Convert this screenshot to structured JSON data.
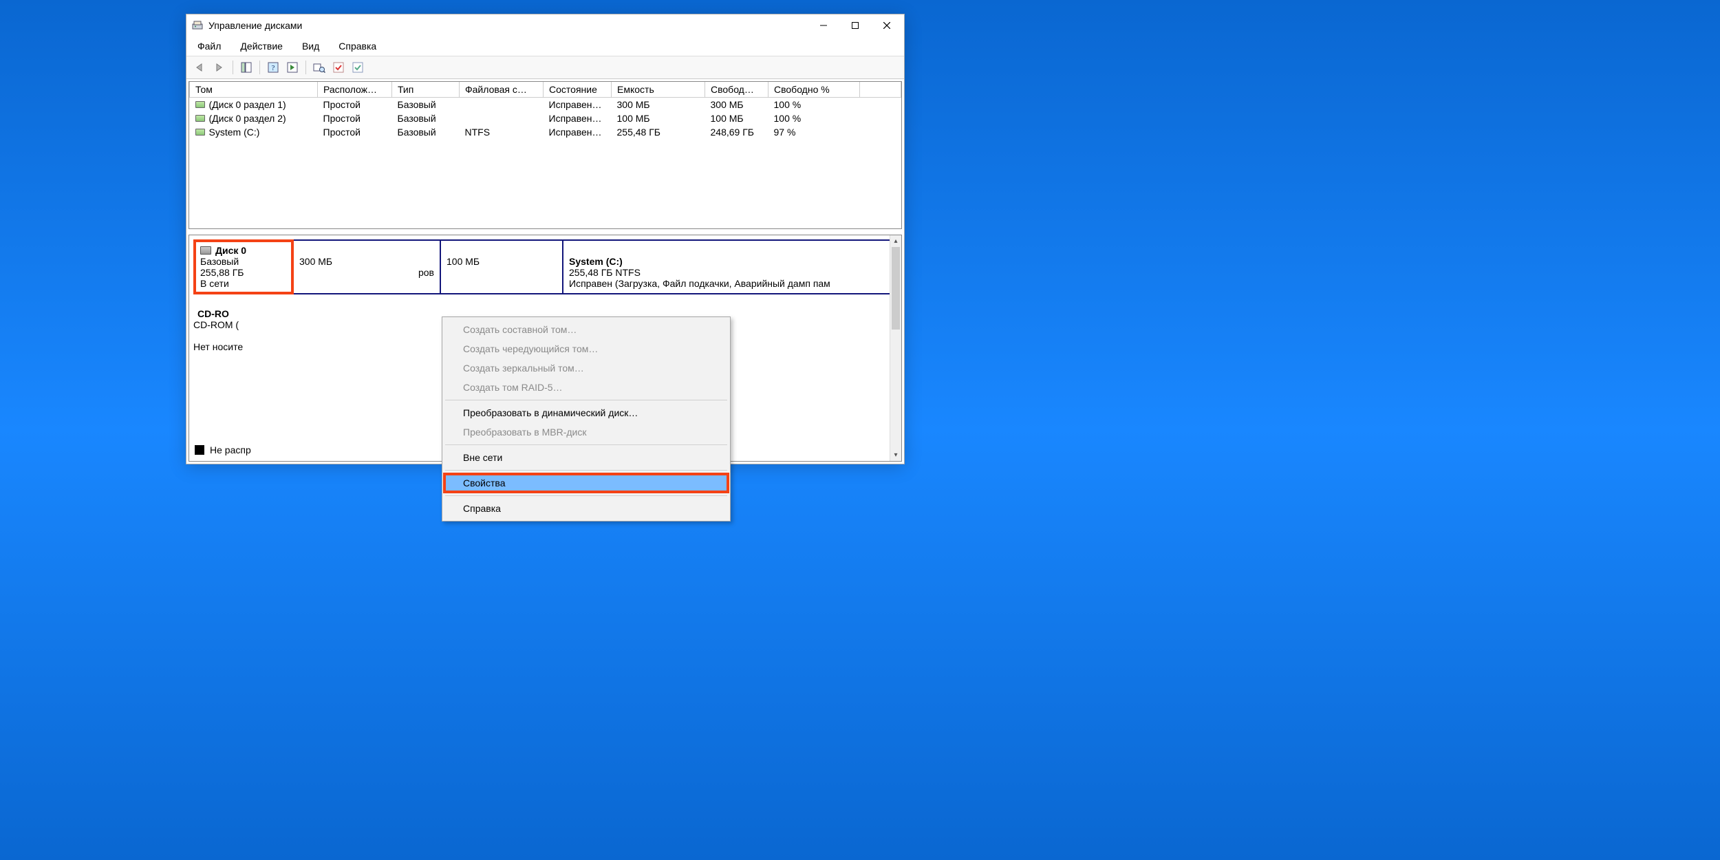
{
  "window": {
    "title": "Управление дисками"
  },
  "menubar": {
    "file": "Файл",
    "action": "Действие",
    "view": "Вид",
    "help": "Справка"
  },
  "columns": {
    "volume": "Том",
    "layout": "Располож…",
    "type": "Тип",
    "fs": "Файловая с…",
    "status": "Состояние",
    "capacity": "Емкость",
    "free": "Свобод…",
    "freepct": "Свободно %"
  },
  "volumes": [
    {
      "name": "(Диск 0 раздел 1)",
      "layout": "Простой",
      "type": "Базовый",
      "fs": "",
      "status": "Исправен…",
      "capacity": "300 МБ",
      "free": "300 МБ",
      "freepct": "100 %"
    },
    {
      "name": "(Диск 0 раздел 2)",
      "layout": "Простой",
      "type": "Базовый",
      "fs": "",
      "status": "Исправен…",
      "capacity": "100 МБ",
      "free": "100 МБ",
      "freepct": "100 %"
    },
    {
      "name": "System (C:)",
      "layout": "Простой",
      "type": "Базовый",
      "fs": "NTFS",
      "status": "Исправен…",
      "capacity": "255,48 ГБ",
      "free": "248,69 ГБ",
      "freepct": "97 %"
    }
  ],
  "disks": [
    {
      "name": "Диск 0",
      "kind": "Базовый",
      "size": "255,88 ГБ",
      "online": "В сети",
      "partitions": [
        {
          "title": "",
          "line1": "300 МБ",
          "line2_trunc": "ров"
        },
        {
          "title": "",
          "line1": "100 МБ",
          "line2_trunc": ""
        },
        {
          "title": "System  (C:)",
          "line1": "255,48 ГБ NTFS",
          "line2_trunc": "Исправен (Загрузка, Файл подкачки, Аварийный дамп пам"
        }
      ]
    },
    {
      "name": "CD-RO",
      "kind": "CD-ROM (",
      "no_media": "Нет носите"
    }
  ],
  "legend": {
    "unallocated": "Не распр"
  },
  "context_menu": {
    "items": [
      {
        "label": "Создать составной том…",
        "disabled": true
      },
      {
        "label": "Создать чередующийся том…",
        "disabled": true
      },
      {
        "label": "Создать зеркальный том…",
        "disabled": true
      },
      {
        "label": "Создать том RAID-5…",
        "disabled": true
      },
      {
        "sep": true
      },
      {
        "label": "Преобразовать в динамический диск…",
        "disabled": false
      },
      {
        "label": "Преобразовать в MBR-диск",
        "disabled": true
      },
      {
        "sep": true
      },
      {
        "label": "Вне сети",
        "disabled": false
      },
      {
        "sep": true
      },
      {
        "label": "Свойства",
        "disabled": false,
        "highlighted": true
      },
      {
        "sep": true
      },
      {
        "label": "Справка",
        "disabled": false
      }
    ]
  }
}
